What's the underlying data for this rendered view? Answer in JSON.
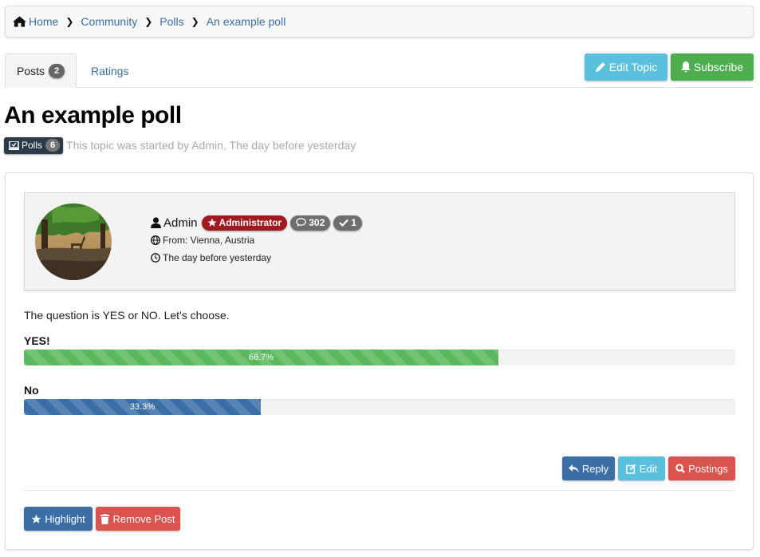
{
  "breadcrumb": {
    "items": [
      "Home",
      "Community",
      "Polls",
      "An example poll"
    ]
  },
  "tabs": {
    "posts_label": "Posts",
    "posts_count": "2",
    "ratings_label": "Ratings"
  },
  "toolbar": {
    "edit_topic_label": "Edit Topic",
    "subscribe_label": "Subscribe"
  },
  "topic": {
    "title": "An example poll",
    "category_label": "Polls",
    "category_count": "6",
    "started_text": "This topic was started by Admin, The day before yesterday"
  },
  "post": {
    "author": {
      "name": "Admin",
      "role": "Administrator",
      "posts_count": "302",
      "solved_count": "1",
      "location": "From: Vienna, Austria",
      "time": "The day before yesterday"
    },
    "text": "The question is YES or NO. Let's choose.",
    "poll": [
      {
        "label": "YES!",
        "percent": 66.7,
        "percent_text": "66.7%",
        "color": "#5cb85c"
      },
      {
        "label": "No",
        "percent": 33.3,
        "percent_text": "33.3%",
        "color": "#3a6ea5"
      }
    ],
    "actions": {
      "reply_label": "Reply",
      "edit_label": "Edit",
      "postings_label": "Postings",
      "highlight_label": "Highlight",
      "remove_label": "Remove Post"
    }
  },
  "colors": {
    "link": "#3a6ea5",
    "info": "#5bc0de",
    "success": "#4cae4c",
    "primary": "#3a6ea5",
    "danger": "#d9534f",
    "admin_badge": "#a11a1e",
    "category_badge": "#2b3a48"
  },
  "icons": {
    "home": "home-icon",
    "chevron": "chevron-right-icon",
    "pencil": "pencil-icon",
    "bell": "bell-icon",
    "user": "user-icon",
    "star": "star-icon",
    "comment": "comment-icon",
    "check": "check-icon",
    "globe": "globe-icon",
    "clock": "clock-icon",
    "reply": "reply-icon",
    "edit": "edit-icon",
    "search": "search-icon",
    "trash": "trash-icon",
    "poll": "poll-icon"
  }
}
